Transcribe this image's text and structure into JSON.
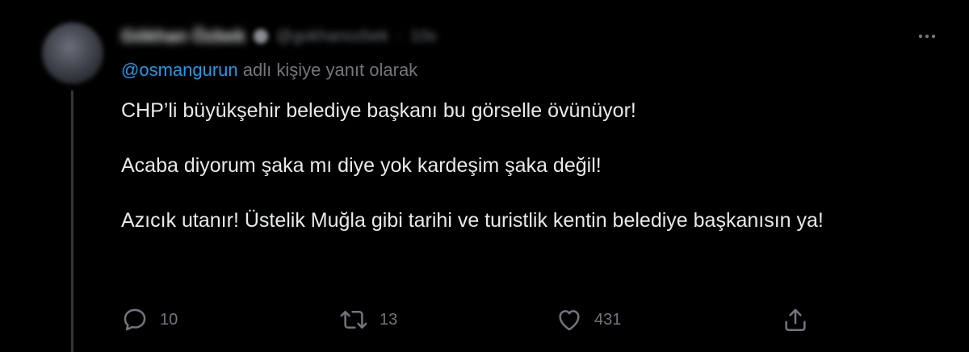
{
  "tweet": {
    "author": {
      "name": "Gökhan Özbek",
      "handle": "@gokhanozbek",
      "separator": "·",
      "time": "10s"
    },
    "reply_context": {
      "mention": "@osmangurun",
      "suffix": " adlı kişiye yanıt olarak"
    },
    "body": [
      "CHP’li büyükşehir belediye başkanı bu görselle övünüyor!",
      "Acaba diyorum şaka mı diye yok kardeşim şaka değil!",
      "Azıcık utanır! Üstelik Muğla gibi tarihi ve turistlik kentin belediye başkanısın ya!"
    ],
    "actions": {
      "reply_count": "10",
      "retweet_count": "13",
      "like_count": "431"
    }
  },
  "colors": {
    "background": "#000000",
    "text": "#e7e9ea",
    "secondary": "#71767b",
    "accent": "#1d9bf0",
    "thread_line": "#333639"
  },
  "icons": {
    "more": "more-horizontal-icon",
    "reply": "reply-bubble-icon",
    "retweet": "retweet-arrows-icon",
    "like": "heart-icon",
    "share": "share-upload-icon"
  }
}
